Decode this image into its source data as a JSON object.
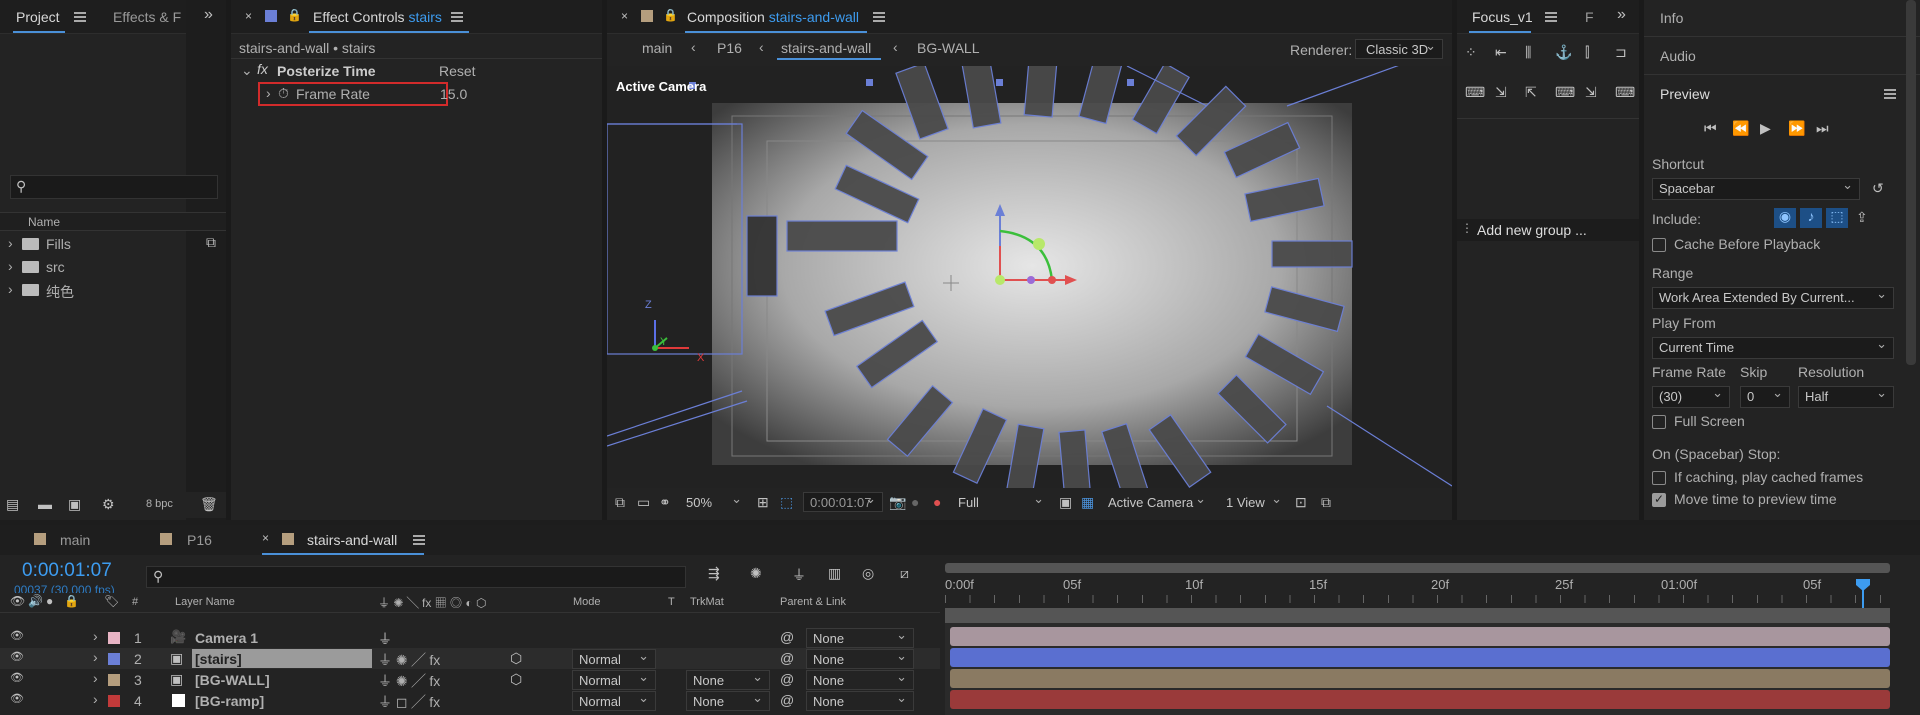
{
  "project": {
    "tab": "Project",
    "tab2": "Effects & F",
    "search_placeholder": "",
    "name_header": "Name",
    "items": [
      {
        "label": "Fills"
      },
      {
        "label": "src"
      },
      {
        "label": "纯色"
      }
    ],
    "bpc": "8 bpc"
  },
  "effect_controls": {
    "tab": "Effect Controls",
    "tab_comp": "stairs",
    "subtitle": "stairs-and-wall • stairs",
    "effect": "Posterize Time",
    "reset": "Reset",
    "prop": "Frame Rate",
    "prop_value": "15.0"
  },
  "composition": {
    "tab": "Composition",
    "tab_comp": "stairs-and-wall",
    "crumbs": [
      "main",
      "P16",
      "stairs-and-wall",
      "BG-WALL"
    ],
    "renderer_label": "Renderer:",
    "renderer": "Classic 3D",
    "active_camera": "Active Camera",
    "zoom": "50%",
    "timecode": "0:00:01:07",
    "resolution": "Full",
    "view": "Active Camera",
    "views": "1 View",
    "axis": {
      "z": "Z",
      "y": "Y",
      "x": "X"
    }
  },
  "focus": {
    "tab": "Focus_v1",
    "tab2": "F",
    "add_group": "Add new group ..."
  },
  "right": {
    "info": "Info",
    "audio": "Audio",
    "preview": "Preview",
    "shortcut_label": "Shortcut",
    "shortcut": "Spacebar",
    "include_label": "Include:",
    "cache_before": "Cache Before Playback",
    "range_label": "Range",
    "range": "Work Area Extended By Current...",
    "play_from_label": "Play From",
    "play_from": "Current Time",
    "frame_rate_label": "Frame Rate",
    "skip_label": "Skip",
    "resolution_label": "Resolution",
    "frame_rate": "(30)",
    "skip": "0",
    "resolution": "Half",
    "full_screen": "Full Screen",
    "stop_label": "On (Spacebar) Stop:",
    "if_caching": "If caching, play cached frames",
    "move_time": "Move time to preview time"
  },
  "timeline": {
    "tabs": [
      "main",
      "P16",
      "stairs-and-wall"
    ],
    "timecode": "0:00:01:07",
    "frames": "00037 (30.000 fps)",
    "headers": {
      "num": "#",
      "name": "Layer Name",
      "mode": "Mode",
      "t": "T",
      "trkmat": "TrkMat",
      "parent": "Parent & Link"
    },
    "ruler": [
      "0:00f",
      "05f",
      "10f",
      "15f",
      "20f",
      "25f",
      "01:00f",
      "05f"
    ],
    "layers": [
      {
        "num": "1",
        "name": "Camera 1",
        "color": "#e8b4c4",
        "mode": "",
        "trkmat": "",
        "parent": "None"
      },
      {
        "num": "2",
        "name": "[stairs]",
        "color": "#6b7fd6",
        "mode": "Normal",
        "trkmat": "",
        "parent": "None"
      },
      {
        "num": "3",
        "name": "[BG-WALL]",
        "color": "#b59e7e",
        "mode": "Normal",
        "trkmat": "None",
        "parent": "None"
      },
      {
        "num": "4",
        "name": "[BG-ramp]",
        "color": "#c23a3a",
        "mode": "Normal",
        "trkmat": "None",
        "parent": "None"
      }
    ]
  }
}
